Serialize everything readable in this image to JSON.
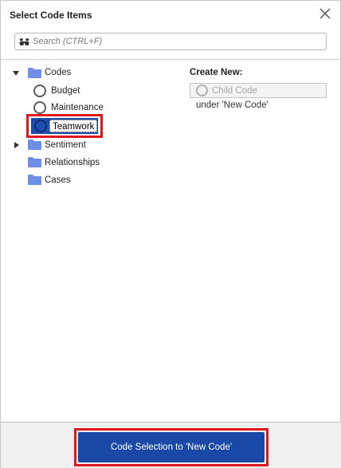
{
  "dialog": {
    "title": "Select Code Items",
    "close_icon": "close-icon"
  },
  "search": {
    "placeholder": "Search (CTRL+F)",
    "value": "",
    "icon": "binoculars-icon"
  },
  "tree": {
    "codes": {
      "label": "Codes",
      "expanded": true,
      "children": [
        {
          "label": "Budget"
        },
        {
          "label": "Maintenance"
        },
        {
          "label": "Teamwork",
          "selected": true
        }
      ]
    },
    "others": [
      {
        "label": "Sentiment",
        "has_children": true
      },
      {
        "label": "Relationships"
      },
      {
        "label": "Cases"
      }
    ]
  },
  "create_new": {
    "title": "Create New:",
    "option_label": "Child Code",
    "under_text": "under 'New Code'"
  },
  "footer": {
    "primary_label": "Code Selection to 'New Code'"
  },
  "colors": {
    "accent": "#1a48a6",
    "highlight": "#e0161e",
    "folder": "#6e8fe8"
  }
}
